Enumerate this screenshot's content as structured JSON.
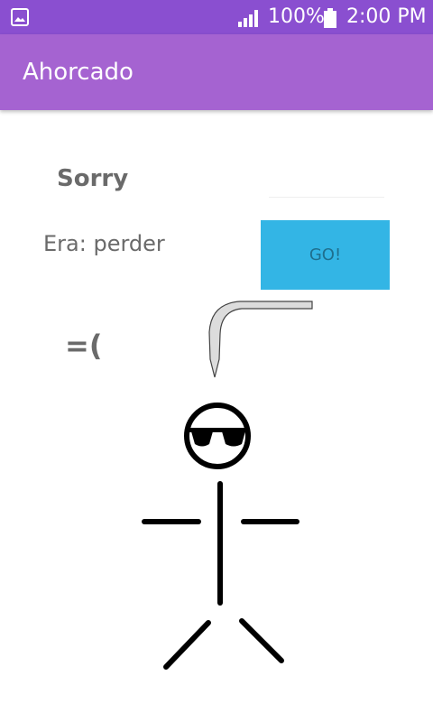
{
  "status_bar": {
    "battery": "100%",
    "time": "2:00 PM"
  },
  "app_bar": {
    "title": "Ahorcado"
  },
  "game": {
    "result_title": "Sorry",
    "word_text": "Era: perder",
    "sad_face": "=(",
    "input_value": "",
    "go_label": "GO!"
  },
  "colors": {
    "status_bar": "#8a4fd0",
    "app_bar": "#a563d1",
    "go_button": "#33b5e5",
    "text_gray": "#6a6a6a"
  },
  "icons": [
    "image-icon",
    "signal-icon",
    "battery-icon",
    "hook-icon",
    "stick-figure"
  ]
}
